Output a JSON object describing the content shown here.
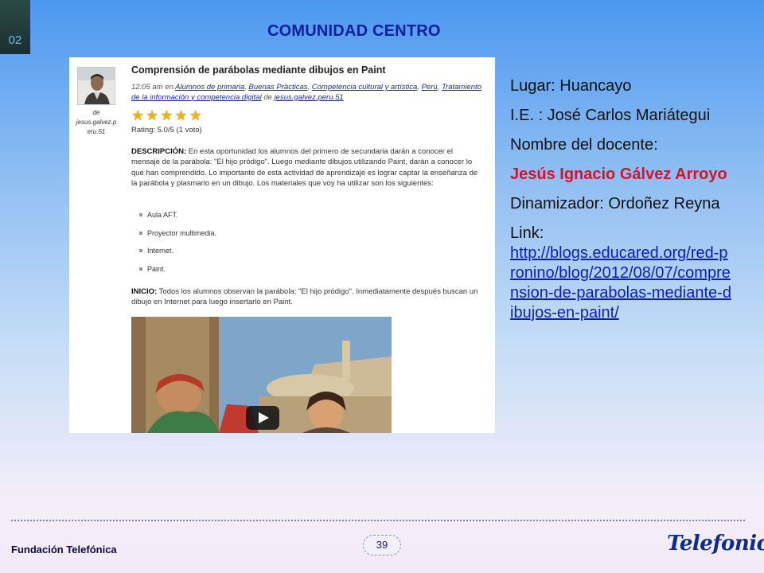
{
  "slide": {
    "number": "02",
    "title": "COMUNIDAD CENTRO"
  },
  "post": {
    "author_label": "de",
    "author_user": "jesus.galvez.peru.51",
    "title": "Comprensión de parábolas mediante dibujos en Paint",
    "meta": {
      "time": "12:05 am",
      "in_label": "en",
      "tags": [
        "Alumnos de primaria",
        "Buenas Prácticas",
        "Competencia cultural y artística",
        "Perú",
        "Tratamiento de la información y competencia digital"
      ],
      "by_label": "de",
      "author": "jesus.galvez.peru.51"
    },
    "rating_text": "Rating: 5.0/5 (1 voto)",
    "rating": {
      "value": 5,
      "max": 5
    },
    "description_label": "DESCRIPCIÓN:",
    "description": "En esta oportunidad los alumnos del primero de secundaria darán a conocer el mensaje de la parábola: \"El hijo pródigo\". Luego mediante dibujos utilizando Paint, darán a conocer lo que han comprendido. Lo importante de esta actividad de aprendizaje es lograr captar la enseñanza de la parábola y plasmarlo en un dibujo. Los materiales que voy ha utilizar son los siguientes:",
    "materials": [
      "Aula AFT.",
      "Proyector multimedia.",
      "Internet.",
      "Paint."
    ],
    "inicio_label": "INICIO:",
    "inicio": "Todos los alumnos observan la parábola: \"El hijo pródigo\". Inmediatamente después buscan un dibujo en Internet para luego insertarlo en Paint."
  },
  "info": {
    "lugar": "Lugar: Huancayo",
    "ie": "I.E. : José Carlos Mariátegui",
    "docente_label": "Nombre del docente:",
    "docente": "Jesús Ignacio Gálvez Arroyo",
    "dinamizador": "Dinamizador: Ordoñez Reyna",
    "link_label": "Link:",
    "link": "http://blogs.educared.org/red-pronino/blog/2012/08/07/comprension-de-parabolas-mediante-dibujos-en-paint/"
  },
  "footer": {
    "org": "Fundación Telefónica",
    "page": "39",
    "logo": "Telefonica"
  },
  "colors": {
    "title": "#0d1f9a",
    "teacher": "#d4142a",
    "link": "#0b1fb5",
    "star": "#f1b10c"
  }
}
